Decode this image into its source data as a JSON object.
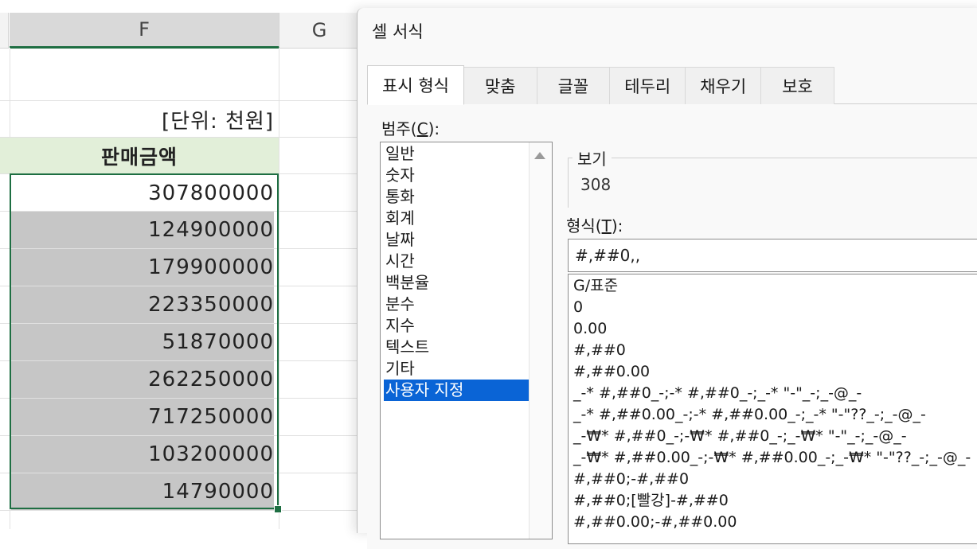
{
  "sheet": {
    "col_f": "F",
    "col_g": "G",
    "unit_label": "[단위: 천원]",
    "header": "판매금액",
    "values": [
      "307800000",
      "124900000",
      "179900000",
      "223350000",
      "51870000",
      "262250000",
      "717250000",
      "103200000",
      "14790000"
    ]
  },
  "dialog": {
    "title": "셀 서식",
    "tabs": [
      "표시 형식",
      "맞춤",
      "글꼴",
      "테두리",
      "채우기",
      "보호"
    ],
    "category_label": "범주(",
    "category_key": "C",
    "category_suffix": "):",
    "categories": [
      "일반",
      "숫자",
      "통화",
      "회계",
      "날짜",
      "시간",
      "백분율",
      "분수",
      "지수",
      "텍스트",
      "기타",
      "사용자 지정"
    ],
    "selected_category": "사용자 지정",
    "preview_label": "보기",
    "preview_value": "308",
    "format_label": "형식(",
    "format_key": "T",
    "format_suffix": "):",
    "format_value": "#,##0,,",
    "formats": [
      "G/표준",
      "0",
      "0.00",
      "#,##0",
      "#,##0.00",
      "_-* #,##0_-;-* #,##0_-;_-* \"-\"_-;_-@_-",
      "_-* #,##0.00_-;-* #,##0.00_-;_-* \"-\"??_-;_-@_-",
      "_-₩* #,##0_-;-₩* #,##0_-;_-₩* \"-\"_-;_-@_-",
      "_-₩* #,##0.00_-;-₩* #,##0.00_-;_-₩* \"-\"??_-;_-@_-",
      "#,##0;-#,##0",
      "#,##0;[빨강]-#,##0",
      "#,##0.00;-#,##0.00"
    ]
  },
  "colors": {
    "selection_border": "#1e6e42",
    "header_fill": "#e2efd9",
    "list_selection": "#0a64d6"
  }
}
